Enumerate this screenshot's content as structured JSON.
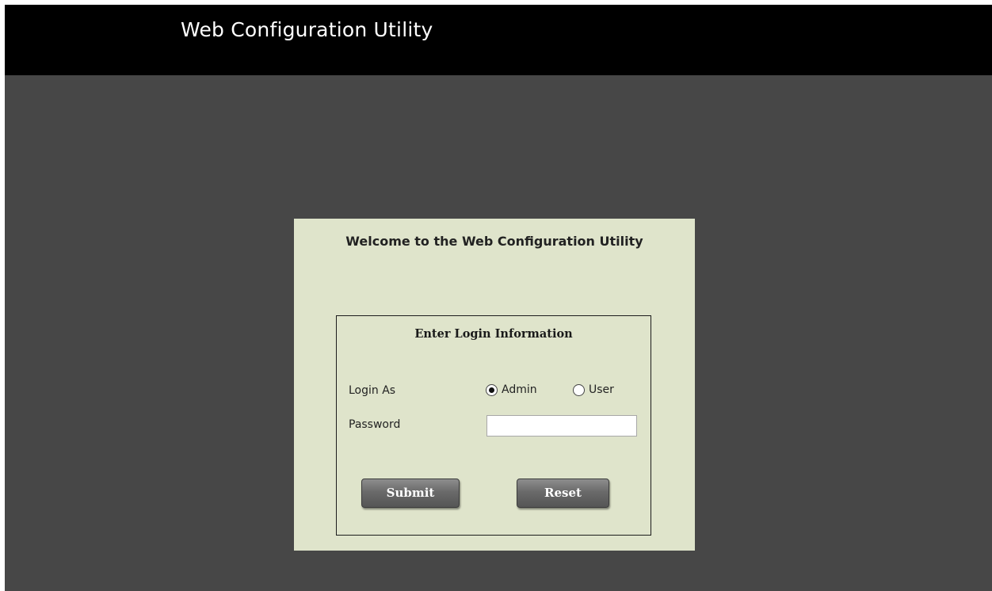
{
  "header": {
    "title": "Web Configuration Utility"
  },
  "panel": {
    "welcome": "Welcome to the Web Configuration Utility"
  },
  "login": {
    "heading": "Enter Login Information",
    "login_as_label": "Login As",
    "options": [
      {
        "label": "Admin",
        "checked": true
      },
      {
        "label": "User",
        "checked": false
      }
    ],
    "password_label": "Password",
    "password_value": "",
    "submit_label": "Submit",
    "reset_label": "Reset"
  },
  "colors": {
    "header_bg": "#000000",
    "page_bg": "#474747",
    "panel_bg": "#dfe4cb",
    "button_bg": "#6a6a6a"
  }
}
